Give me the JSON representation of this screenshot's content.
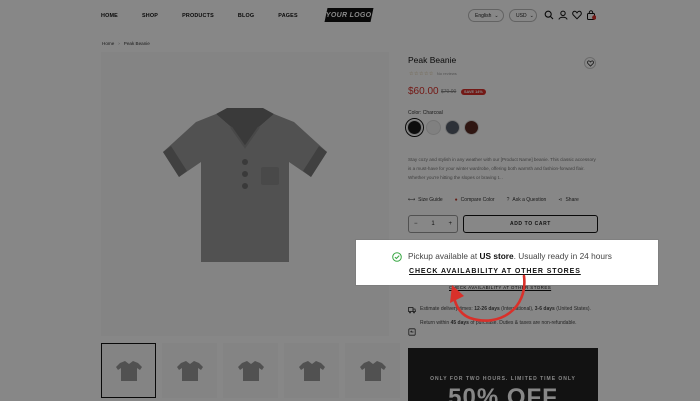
{
  "header": {
    "nav": [
      "HOME",
      "SHOP",
      "PRODUCTS",
      "BLOG",
      "PAGES"
    ],
    "logo": "YOUR LOGO",
    "language": "English",
    "currency": "USD",
    "cart_count": "0"
  },
  "breadcrumb": {
    "home": "Home",
    "current": "Peak Beanie"
  },
  "product": {
    "title": "Peak Beanie",
    "stars": "☆☆☆☆☆",
    "reviews": "No reviews",
    "price": "$60.00",
    "old_price": "$70.00",
    "badge": "SAVE 14%",
    "color_label": "Color: Charcoal",
    "swatches": [
      "#1a1a1a",
      "#f2f2f2",
      "#555e6b",
      "#5a2a22"
    ],
    "description": "Stay cozy and stylish in any weather with our [Product Name] beanie. This classic accessory is a must-have for your winter wardrobe, offering both warmth and fashion-forward flair. Whether you're hitting the slopes or braving t...",
    "tools": {
      "size_guide": "Size Guide",
      "compare": "Compare Color",
      "ask": "Ask a Question",
      "share": "Share"
    },
    "qty_minus": "−",
    "qty": "1",
    "qty_plus": "+",
    "add_to_cart": "ADD TO CART",
    "check_small": "CHECK AVAILABILITY AT OTHER STORES",
    "delivery_pre": "Estimate delivery times: ",
    "delivery_intl": "12-26 days",
    "delivery_mid": " (International), ",
    "delivery_us": "3-6 days",
    "delivery_post": " (United States).",
    "return_pre": "Return within ",
    "return_days": "45 days",
    "return_post": " of purchase. Duties & taxes are non-refundable.",
    "promo_sub": "ONLY FOR TWO HOURS. LIMITED TIME ONLY",
    "promo_big": "50% OFF"
  },
  "popup": {
    "text_pre": "Pickup available at ",
    "store": "US store",
    "text_post": ". Usually ready in 24 hours",
    "link": "CHECK AVAILABILITY AT OTHER STORES"
  },
  "colors": {
    "accent_red": "#d9302a",
    "check_green": "#3aa845"
  }
}
